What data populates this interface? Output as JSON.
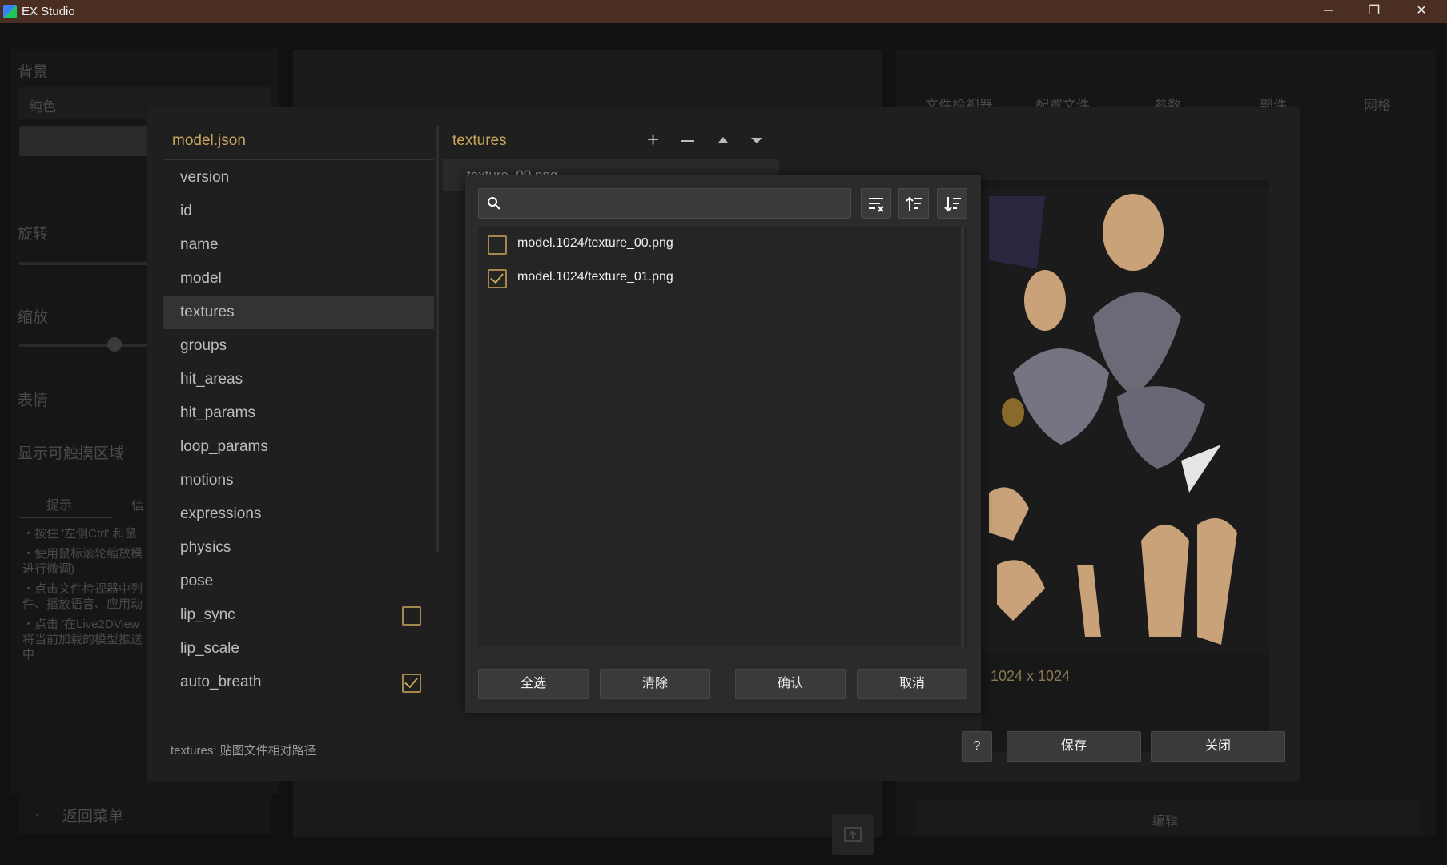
{
  "window": {
    "title": "EX Studio",
    "minimize": "─",
    "restore": "❐",
    "close": "✕"
  },
  "left_panel": {
    "background_label": "背景",
    "background_value": "纯色",
    "rotate_label": "旋转",
    "scale_label": "缩放",
    "expression_label": "表情",
    "hit_area_label": "显示可触摸区域",
    "tabs": [
      "提示",
      "信"
    ],
    "tips": [
      "・按住 '左侧Ctrl' 和鼠",
      "・使用鼠标滚轮缩放模",
      "进行微调)",
      "・点击文件检视器中列",
      "件、播放语音、应用动",
      "・点击 '在Live2DView",
      "将当前加载的模型推送",
      "中"
    ],
    "back_label": "返回菜单"
  },
  "right_panel": {
    "tabs": [
      "文件检视器",
      "配置文件",
      "参数",
      "部件",
      "网格"
    ],
    "edit_label": "编辑"
  },
  "modal": {
    "file_title": "model.json",
    "keys": [
      "version",
      "id",
      "name",
      "model",
      "textures",
      "groups",
      "hit_areas",
      "hit_params",
      "loop_params",
      "motions",
      "expressions",
      "physics",
      "pose",
      "lip_sync",
      "lip_scale",
      "auto_breath"
    ],
    "selected_key": "textures",
    "lip_sync_checked": false,
    "auto_breath_checked": true,
    "textures_header": "textures",
    "texture_row_partial": "texture_00.png",
    "texture_size": "1024 x 1024",
    "help_label": "?",
    "save_label": "保存",
    "close_label": "关闭",
    "status_text": "textures: 贴图文件相对路径"
  },
  "dialog": {
    "search_placeholder": "",
    "files": [
      {
        "name": "model.1024/texture_00.png",
        "checked": false
      },
      {
        "name": "model.1024/texture_01.png",
        "checked": true
      }
    ],
    "select_all": "全选",
    "clear": "清除",
    "confirm": "确认",
    "cancel": "取消"
  },
  "colors": {
    "accent": "#c9a75a",
    "titlebar": "#4a2e22",
    "dialog_bg": "#2b2b2b"
  }
}
